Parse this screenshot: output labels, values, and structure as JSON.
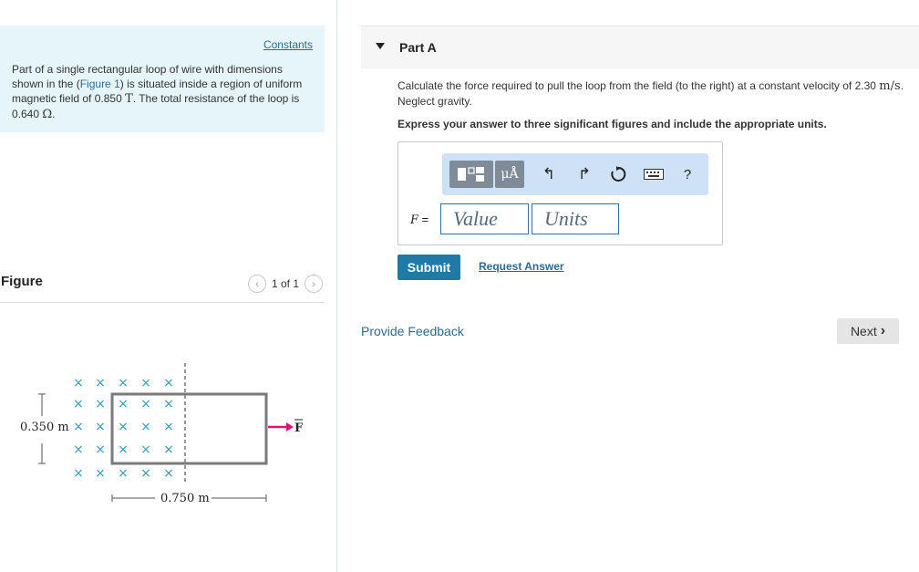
{
  "problem": {
    "constants_link": "Constants",
    "text_1": "Part of a single rectangular loop of wire with dimensions shown in the (",
    "figure_link": "Figure 1",
    "text_2": ") is situated inside a region of uniform magnetic field of 0.850 ",
    "field_unit": "T",
    "text_3": ". The total resistance of the loop is 0.640 ",
    "resistance_unit": "Ω",
    "text_4": "."
  },
  "figure": {
    "title": "Figure",
    "pager": "1 of 1",
    "prev_icon": "chevron-left-icon",
    "next_icon": "chevron-right-icon",
    "height_label": "0.350 m",
    "width_label": "0.750 m",
    "force_label": "F",
    "field_symbol": "×",
    "arrow_color": "#e0137a"
  },
  "part": {
    "title": "Part A",
    "question_1": "Calculate the force required to pull the loop from the field (to the right) at a constant velocity of 2.30 ",
    "velocity_unit": "m/s",
    "question_2": ". Neglect gravity.",
    "instruction": "Express your answer to three significant figures and include the appropriate units."
  },
  "answer": {
    "units_button": "μÅ",
    "toolbar_icons": [
      "templates-icon",
      "units-icon",
      "undo-icon",
      "redo-icon",
      "reset-icon",
      "keyboard-icon",
      "help-icon"
    ],
    "help_label": "?",
    "variable_label": "F",
    "equals": "=",
    "value_placeholder": "Value",
    "units_placeholder": "Units"
  },
  "actions": {
    "submit": "Submit",
    "request_answer": "Request Answer",
    "provide_feedback": "Provide Feedback",
    "next": "Next"
  },
  "colors": {
    "accent": "#1e7ba8",
    "link": "#2c6b8f",
    "problem_bg": "#e5f5f8",
    "toolbar_bg": "#cfe2f5"
  }
}
